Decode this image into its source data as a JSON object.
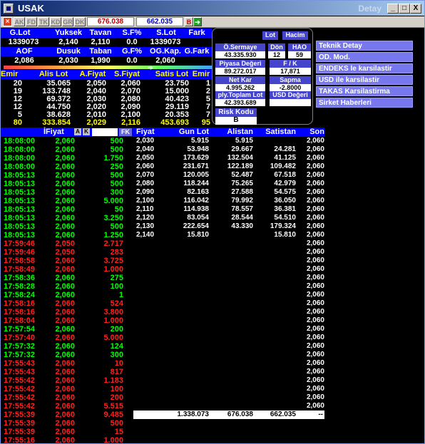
{
  "window": {
    "title": "USAK",
    "detay": "Detay",
    "btn_min": "_",
    "btn_max": "□",
    "btn_close": "X"
  },
  "toolbar": {
    "tabs": [
      "AK",
      "FD",
      "TK",
      "KD",
      "GR",
      "DK"
    ],
    "val1": "676.038",
    "val2": "662.035",
    "b_label": "B"
  },
  "summary": {
    "headers1": [
      "G.Lot",
      "Yuksek",
      "Tavan",
      "S.F%",
      "S.Lot",
      "Fark"
    ],
    "values1": [
      "1339073",
      "2,140",
      "2,110",
      "0.0",
      "1339073",
      ""
    ],
    "headers2": [
      "AOF",
      "Dusuk",
      "Taban",
      "G.F%",
      "OG.Kap.",
      "G.Fark"
    ],
    "values2": [
      "2,086",
      "2,030",
      "1,990",
      "0.0",
      "2,060",
      ""
    ]
  },
  "depth": {
    "headers": [
      "Emir",
      "Alis Lot",
      "A.Fiyat",
      "S.Fiyat",
      "Satis Lot",
      "Emir"
    ],
    "rows": [
      [
        "20",
        "35.065",
        "2,050",
        "2,060",
        "23.750",
        "1"
      ],
      [
        "19",
        "133.748",
        "2,040",
        "2,070",
        "15.000",
        "2"
      ],
      [
        "12",
        "69.372",
        "2,030",
        "2,080",
        "40.423",
        "5"
      ],
      [
        "12",
        "44.750",
        "2,020",
        "2,090",
        "29.119",
        "7"
      ],
      [
        "5",
        "38.628",
        "2,010",
        "2,100",
        "20.353",
        "7"
      ]
    ],
    "totals": [
      "80",
      "333.854",
      "2,029",
      "2,116",
      "453.693",
      "95"
    ]
  },
  "info": {
    "lot_btn": "Lot",
    "hacim_btn": "Hacim",
    "sermaye_label": "Ö.Sermaye",
    "sermaye_value": "43.335.930",
    "don_label": "Dön",
    "don_value": "12",
    "hao_label": "HAO",
    "hao_value": "59",
    "piyasa_label": "Piyasa Değeri",
    "piyasa_value": "89.272.017",
    "fk_label": "F / K",
    "fk_value": "17,871",
    "netkar_label": "Net Kar",
    "netkar_value": "4.995.262",
    "sapma_label": "Sapma",
    "sapma_value": "-2.8000",
    "ply_label": "ply.Toplam Lot",
    "ply_value": "42.393.689",
    "usd_label": "USD Değeri",
    "risk_label": "Risk Kodu",
    "risk_value": "B"
  },
  "links": [
    "Teknik Detay",
    "OD. Mod.",
    "ENDEKS le karsilastir",
    "USD ile karsilastir",
    "TAKAS Karsilastirma",
    "Sirket Haberleri"
  ],
  "trades_header": {
    "fiyat": "İFiyat",
    "a": "A",
    "k": "K",
    "fk": "FK"
  },
  "trades": [
    [
      "18:08:00",
      "2,060",
      "500",
      "g"
    ],
    [
      "18:08:00",
      "2,060",
      "500",
      "g"
    ],
    [
      "18:08:00",
      "2,060",
      "1.750",
      "g"
    ],
    [
      "18:08:00",
      "2,060",
      "250",
      "g"
    ],
    [
      "18:05:13",
      "2,060",
      "500",
      "g"
    ],
    [
      "18:05:13",
      "2,060",
      "500",
      "g"
    ],
    [
      "18:05:13",
      "2,060",
      "300",
      "g"
    ],
    [
      "18:05:13",
      "2,060",
      "5.000",
      "g"
    ],
    [
      "18:05:13",
      "2,060",
      "50",
      "g"
    ],
    [
      "18:05:13",
      "2,060",
      "3.250",
      "g"
    ],
    [
      "18:05:13",
      "2,060",
      "500",
      "g"
    ],
    [
      "18:05:13",
      "2,060",
      "1.250",
      "g"
    ],
    [
      "17:59:46",
      "2,050",
      "2.717",
      "r"
    ],
    [
      "17:59:46",
      "2,050",
      "283",
      "r"
    ],
    [
      "17:58:58",
      "2,060",
      "3.725",
      "r"
    ],
    [
      "17:58:49",
      "2,060",
      "1.000",
      "r"
    ],
    [
      "17:58:36",
      "2,060",
      "275",
      "g"
    ],
    [
      "17:58:28",
      "2,060",
      "100",
      "g"
    ],
    [
      "17:58:24",
      "2,060",
      "1",
      "g"
    ],
    [
      "17:58:16",
      "2,060",
      "524",
      "r"
    ],
    [
      "17:58:16",
      "2,060",
      "3.800",
      "r"
    ],
    [
      "17:58:04",
      "2,060",
      "1.000",
      "r"
    ],
    [
      "17:57:54",
      "2,060",
      "200",
      "g"
    ],
    [
      "17:57:40",
      "2,060",
      "5.000",
      "r"
    ],
    [
      "17:57:32",
      "2,060",
      "124",
      "g"
    ],
    [
      "17:57:32",
      "2,060",
      "300",
      "g"
    ],
    [
      "17:55:43",
      "2,060",
      "10",
      "r"
    ],
    [
      "17:55:43",
      "2,060",
      "817",
      "r"
    ],
    [
      "17:55:42",
      "2,060",
      "1.183",
      "r"
    ],
    [
      "17:55:42",
      "2,060",
      "100",
      "r"
    ],
    [
      "17:55:42",
      "2,060",
      "200",
      "r"
    ],
    [
      "17:55:42",
      "2,060",
      "5.515",
      "r"
    ],
    [
      "17:55:39",
      "2,060",
      "9.485",
      "r"
    ],
    [
      "17:55:39",
      "2,060",
      "500",
      "r"
    ],
    [
      "17:55:39",
      "2,060",
      "15",
      "r"
    ],
    [
      "17:55:16",
      "2,060",
      "1.000",
      "r"
    ]
  ],
  "dist_header": [
    "Fiyat",
    "Gun Lot",
    "Alistan",
    "Satistan",
    "Son"
  ],
  "dist_rows": [
    [
      "2,030",
      "5.915",
      "5.915",
      "",
      "2,060"
    ],
    [
      "2,040",
      "53.948",
      "29.667",
      "24.281",
      "2,060"
    ],
    [
      "2,050",
      "173.629",
      "132.504",
      "41.125",
      "2,060"
    ],
    [
      "2,060",
      "231.671",
      "122.189",
      "109.482",
      "2,060"
    ],
    [
      "2,070",
      "120.005",
      "52.487",
      "67.518",
      "2,060"
    ],
    [
      "2,080",
      "118.244",
      "75.265",
      "42.979",
      "2,060"
    ],
    [
      "2,090",
      "82.163",
      "27.588",
      "54.575",
      "2,060"
    ],
    [
      "2,100",
      "116.042",
      "79.992",
      "36.050",
      "2,060"
    ],
    [
      "2,110",
      "114.938",
      "78.557",
      "36.381",
      "2,060"
    ],
    [
      "2,120",
      "83.054",
      "28.544",
      "54.510",
      "2,060"
    ],
    [
      "2,130",
      "222.654",
      "43.330",
      "179.324",
      "2,060"
    ],
    [
      "2,140",
      "15.810",
      "",
      "15.810",
      "2,060"
    ]
  ],
  "son_col": [
    "2,060",
    "2,060",
    "2,060",
    "2,060",
    "2,060",
    "2,060",
    "2,060",
    "2,060",
    "2,060",
    "2,060",
    "2,060",
    "2,060",
    "2,060",
    "2,060",
    "2,060",
    "2,060",
    "2,060",
    "2,060",
    "2,060",
    "2,060",
    "2,060",
    "2,060",
    "2,060",
    "2,060",
    "2,060",
    "2,060",
    "2,060",
    "2,060",
    "2,060",
    "2,060",
    "2,060",
    "2,060",
    "2,060"
  ],
  "dist_totals": [
    "1.338.073",
    "676.038",
    "662.035",
    "--"
  ],
  "colors": {
    "green": "#00ff00",
    "red": "#ff2020",
    "yellow": "#ffff00",
    "blue_band": "#0000ff",
    "link_bg": "#7777ee"
  }
}
